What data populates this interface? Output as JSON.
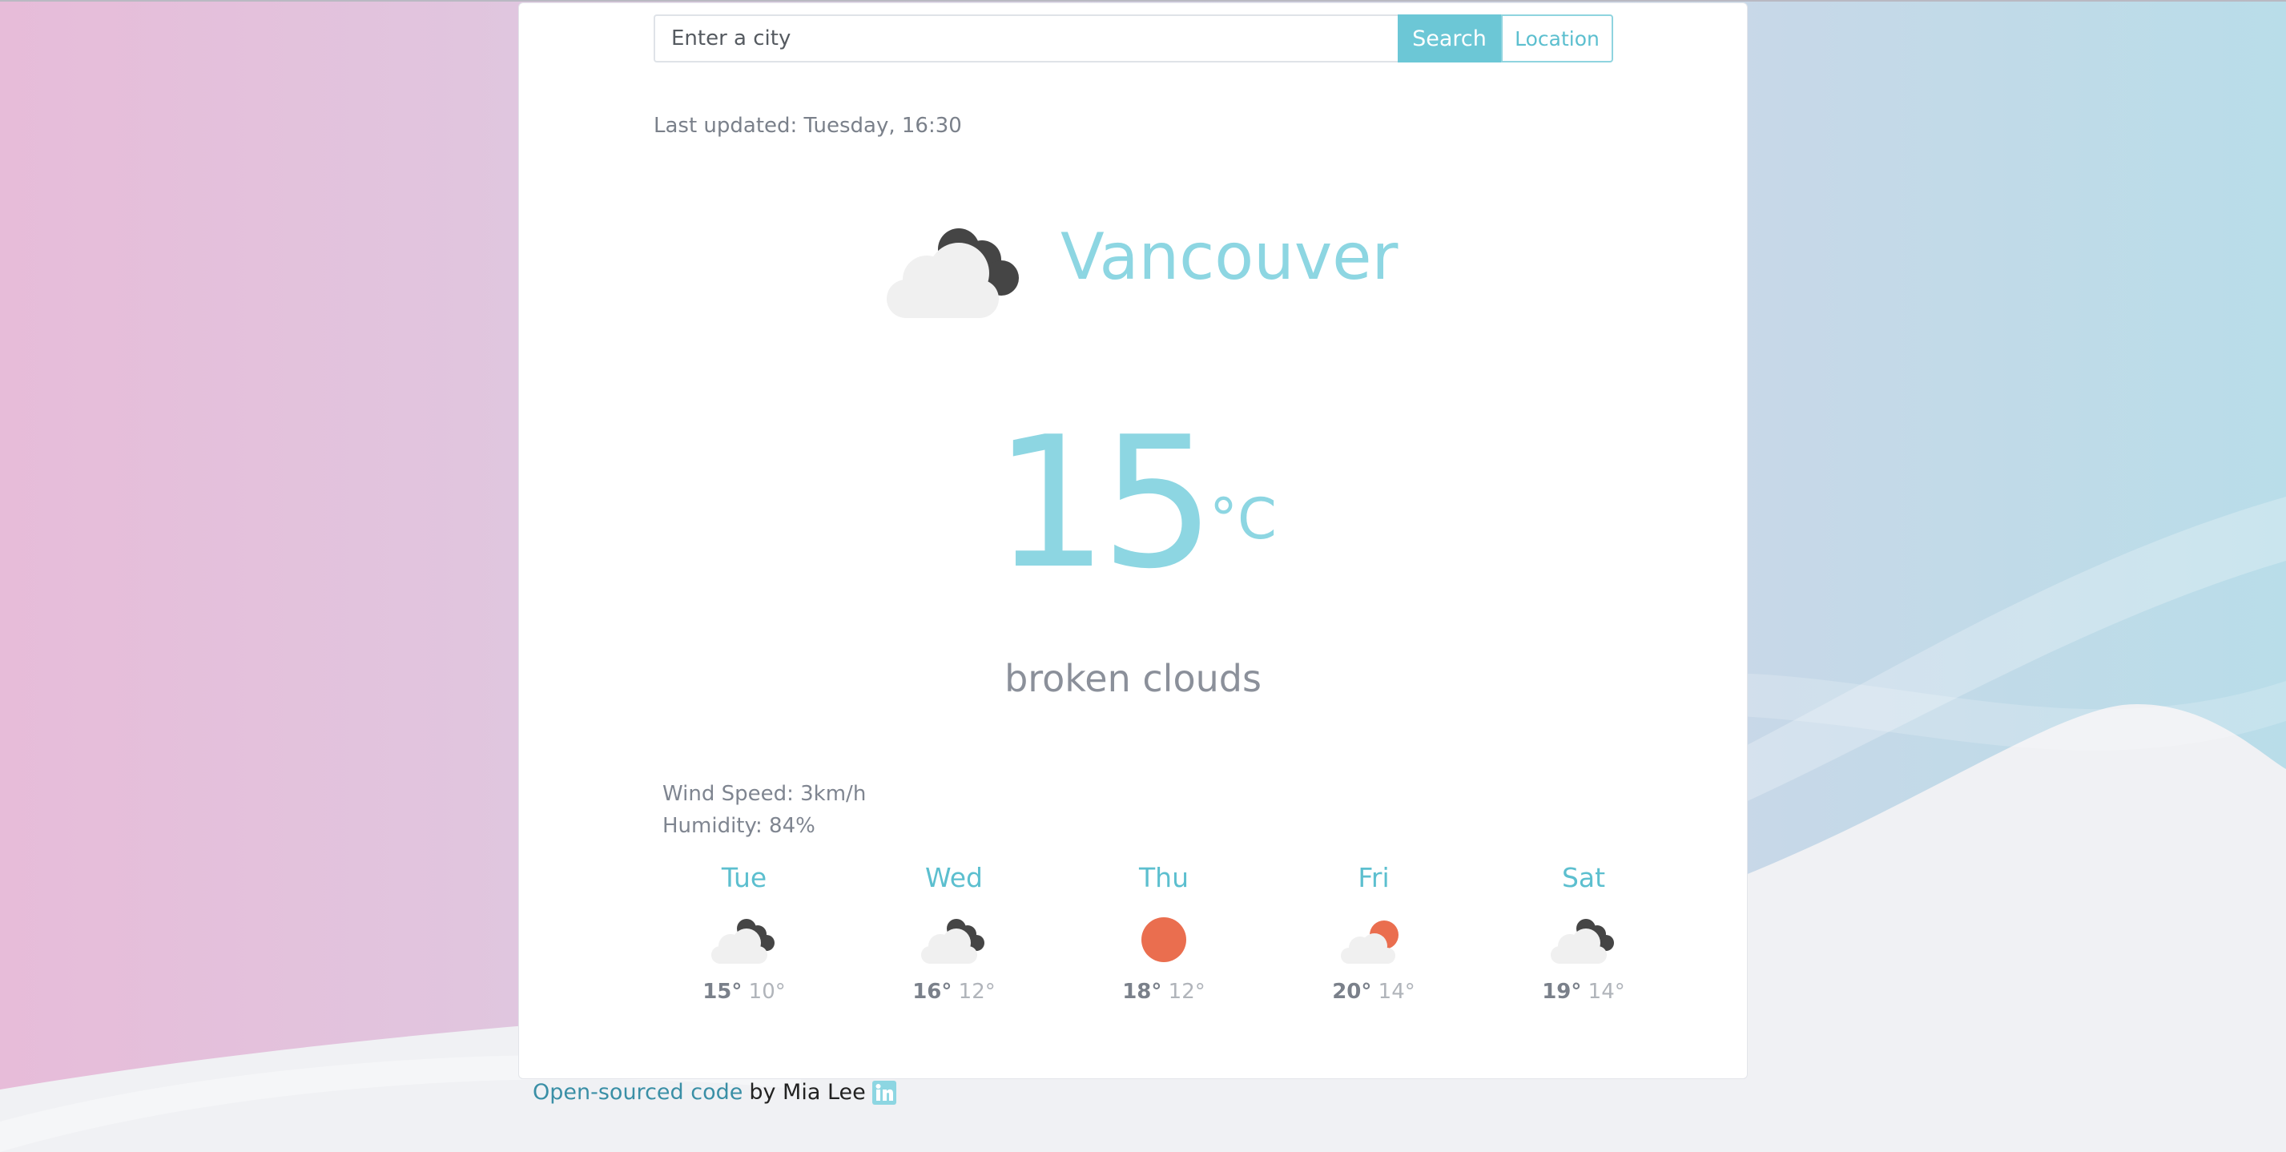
{
  "search": {
    "placeholder": "Enter a city",
    "search_label": "Search",
    "location_label": "Location"
  },
  "last_updated": "Last updated: Tuesday, 16:30",
  "current": {
    "city": "Vancouver",
    "icon": "broken-clouds-icon",
    "temperature": "15",
    "unit": "°C",
    "description": "broken clouds",
    "wind": "Wind Speed: 3km/h",
    "humidity": "Humidity: 84%"
  },
  "forecast": [
    {
      "day": "Tue",
      "icon": "broken-clouds-icon",
      "high": "15°",
      "low": "10°"
    },
    {
      "day": "Wed",
      "icon": "broken-clouds-icon",
      "high": "16°",
      "low": "12°"
    },
    {
      "day": "Thu",
      "icon": "clear-sun-icon",
      "high": "18°",
      "low": "12°"
    },
    {
      "day": "Fri",
      "icon": "sun-cloud-icon",
      "high": "20°",
      "low": "14°"
    },
    {
      "day": "Sat",
      "icon": "broken-clouds-icon",
      "high": "19°",
      "low": "14°"
    }
  ],
  "footer": {
    "link_text": "Open-sourced code",
    "by_text": "by Mia Lee",
    "social_icon": "linkedin-icon"
  },
  "colors": {
    "accent": "#6cc7d6",
    "temperature": "#8dd6e2",
    "sun": "#ea6e4f",
    "dark_cloud": "#454545",
    "light_cloud": "#f0f0f0"
  }
}
